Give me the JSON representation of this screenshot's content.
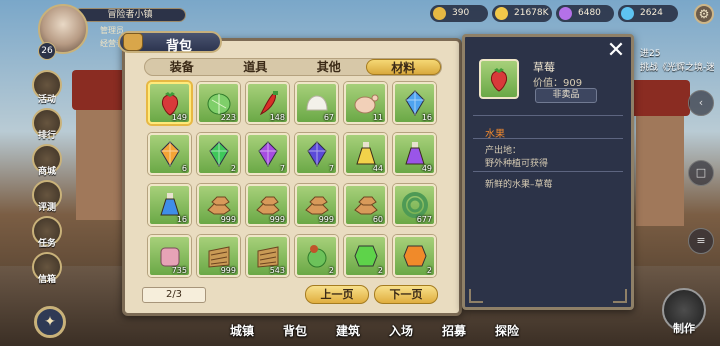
{
  "player": {
    "name": "冒险者小镇",
    "level": "26",
    "line1": "管理员",
    "line2": "经营者"
  },
  "resources": [
    {
      "name": "crown",
      "value": "390",
      "color": "#e6b843"
    },
    {
      "name": "gold",
      "value": "21678K",
      "color": "#f2c84a"
    },
    {
      "name": "gem-purple",
      "value": "6480",
      "color": "#b471e8"
    },
    {
      "name": "diamond",
      "value": "2624",
      "color": "#5ec3f1"
    }
  ],
  "sidebar": [
    "活动",
    "排行",
    "商城",
    "评测",
    "任务",
    "信箱"
  ],
  "bottom_menu": [
    "城镇",
    "背包",
    "建筑",
    "入场",
    "招募",
    "探险"
  ],
  "right_side": {
    "top_text": "进25",
    "challenge_text": "挑战《光辉之境-迷",
    "craft_label": "制作"
  },
  "bag": {
    "title": "背包",
    "tabs": [
      {
        "label": "装备",
        "active": false
      },
      {
        "label": "道具",
        "active": false
      },
      {
        "label": "其他",
        "active": false
      },
      {
        "label": "材料",
        "active": true
      }
    ],
    "page": "2/3",
    "prev_label": "上一页",
    "next_label": "下一页",
    "items": [
      {
        "icon": "strawberry",
        "count": "149",
        "color": "#d83a3a",
        "selected": true
      },
      {
        "icon": "cabbage",
        "count": "223",
        "color": "#7fcf6a"
      },
      {
        "icon": "chili",
        "count": "148",
        "color": "#d83028"
      },
      {
        "icon": "flour",
        "count": "67",
        "color": "#f3f1ea"
      },
      {
        "icon": "chicken",
        "count": "11",
        "color": "#f2d0b8"
      },
      {
        "icon": "blue-crystal",
        "count": "16",
        "color": "#4ea3f0"
      },
      {
        "icon": "orange-crystal",
        "count": "6",
        "color": "#f3a436"
      },
      {
        "icon": "green-crystal",
        "count": "2",
        "color": "#3fc85a"
      },
      {
        "icon": "purple-crystal",
        "count": "7",
        "color": "#a64de0"
      },
      {
        "icon": "indigo-crystal",
        "count": "7",
        "color": "#5b4ad8"
      },
      {
        "icon": "yellow-potion",
        "count": "44",
        "color": "#f2d24a"
      },
      {
        "icon": "purple-potion",
        "count": "49",
        "color": "#9a55e8"
      },
      {
        "icon": "blue-potion",
        "count": "16",
        "color": "#3f8ee8"
      },
      {
        "icon": "copper-ingot",
        "count": "999",
        "color": "#d89a5a"
      },
      {
        "icon": "copper-ingot",
        "count": "999",
        "color": "#d89a5a"
      },
      {
        "icon": "copper-ingot",
        "count": "999",
        "color": "#d89a5a"
      },
      {
        "icon": "copper-ingot",
        "count": "60",
        "color": "#d89a5a"
      },
      {
        "icon": "rope",
        "count": "677",
        "color": "#4e9a55"
      },
      {
        "icon": "bone-ore",
        "count": "735",
        "color": "#e7a3b6"
      },
      {
        "icon": "wood",
        "count": "999",
        "color": "#c99a55"
      },
      {
        "icon": "wood",
        "count": "543",
        "color": "#c99a55"
      },
      {
        "icon": "vegetable",
        "count": "2",
        "color": "#6cc25a"
      },
      {
        "icon": "green-gem",
        "count": "2",
        "color": "#5ed34a"
      },
      {
        "icon": "orange-gem",
        "count": "2",
        "color": "#f08a2a"
      }
    ]
  },
  "detail": {
    "name": "草莓",
    "price": "价值：909",
    "tag": "非卖品",
    "category": "水果",
    "source_label": "产出地：",
    "source_value": "野外种植可获得",
    "description": "新鲜的水果–草莓",
    "icon_color": "#d83a3a"
  }
}
